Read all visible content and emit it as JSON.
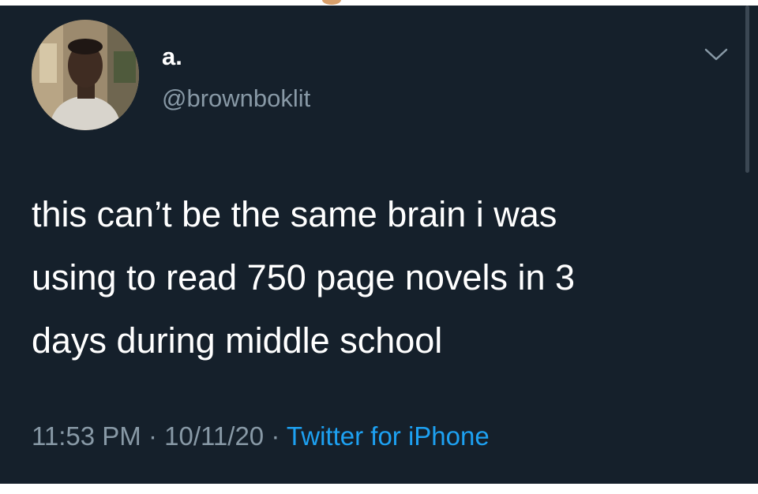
{
  "tweet": {
    "display_name": "a.",
    "handle": "@brownboklit",
    "text_lines": [
      "this can’t be the same brain i was",
      "using to read 750 page novels in 3",
      "days during middle school"
    ],
    "time": "11:53 PM",
    "date": "10/11/20",
    "separator": "·",
    "source": "Twitter for iPhone",
    "icons": {
      "menu": "chevron-down-icon",
      "avatar": "avatar"
    }
  },
  "colors": {
    "background": "#15202b",
    "primary_text": "#ffffff",
    "secondary_text": "#8899a6",
    "link": "#1da1f2"
  }
}
